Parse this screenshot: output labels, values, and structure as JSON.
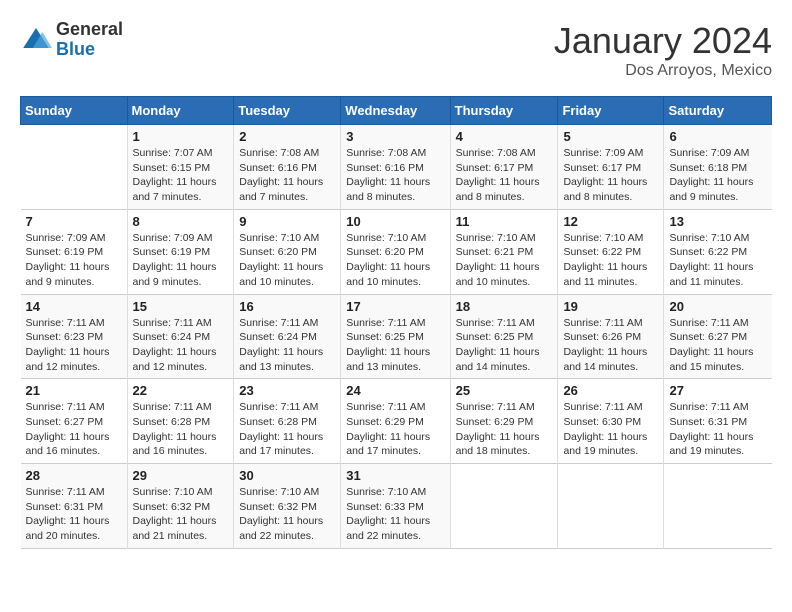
{
  "header": {
    "logo_general": "General",
    "logo_blue": "Blue",
    "month_year": "January 2024",
    "location": "Dos Arroyos, Mexico"
  },
  "columns": [
    "Sunday",
    "Monday",
    "Tuesday",
    "Wednesday",
    "Thursday",
    "Friday",
    "Saturday"
  ],
  "weeks": [
    [
      {
        "day": "",
        "info": ""
      },
      {
        "day": "1",
        "info": "Sunrise: 7:07 AM\nSunset: 6:15 PM\nDaylight: 11 hours\nand 7 minutes."
      },
      {
        "day": "2",
        "info": "Sunrise: 7:08 AM\nSunset: 6:16 PM\nDaylight: 11 hours\nand 7 minutes."
      },
      {
        "day": "3",
        "info": "Sunrise: 7:08 AM\nSunset: 6:16 PM\nDaylight: 11 hours\nand 8 minutes."
      },
      {
        "day": "4",
        "info": "Sunrise: 7:08 AM\nSunset: 6:17 PM\nDaylight: 11 hours\nand 8 minutes."
      },
      {
        "day": "5",
        "info": "Sunrise: 7:09 AM\nSunset: 6:17 PM\nDaylight: 11 hours\nand 8 minutes."
      },
      {
        "day": "6",
        "info": "Sunrise: 7:09 AM\nSunset: 6:18 PM\nDaylight: 11 hours\nand 9 minutes."
      }
    ],
    [
      {
        "day": "7",
        "info": "Sunrise: 7:09 AM\nSunset: 6:19 PM\nDaylight: 11 hours\nand 9 minutes."
      },
      {
        "day": "8",
        "info": "Sunrise: 7:09 AM\nSunset: 6:19 PM\nDaylight: 11 hours\nand 9 minutes."
      },
      {
        "day": "9",
        "info": "Sunrise: 7:10 AM\nSunset: 6:20 PM\nDaylight: 11 hours\nand 10 minutes."
      },
      {
        "day": "10",
        "info": "Sunrise: 7:10 AM\nSunset: 6:20 PM\nDaylight: 11 hours\nand 10 minutes."
      },
      {
        "day": "11",
        "info": "Sunrise: 7:10 AM\nSunset: 6:21 PM\nDaylight: 11 hours\nand 10 minutes."
      },
      {
        "day": "12",
        "info": "Sunrise: 7:10 AM\nSunset: 6:22 PM\nDaylight: 11 hours\nand 11 minutes."
      },
      {
        "day": "13",
        "info": "Sunrise: 7:10 AM\nSunset: 6:22 PM\nDaylight: 11 hours\nand 11 minutes."
      }
    ],
    [
      {
        "day": "14",
        "info": "Sunrise: 7:11 AM\nSunset: 6:23 PM\nDaylight: 11 hours\nand 12 minutes."
      },
      {
        "day": "15",
        "info": "Sunrise: 7:11 AM\nSunset: 6:24 PM\nDaylight: 11 hours\nand 12 minutes."
      },
      {
        "day": "16",
        "info": "Sunrise: 7:11 AM\nSunset: 6:24 PM\nDaylight: 11 hours\nand 13 minutes."
      },
      {
        "day": "17",
        "info": "Sunrise: 7:11 AM\nSunset: 6:25 PM\nDaylight: 11 hours\nand 13 minutes."
      },
      {
        "day": "18",
        "info": "Sunrise: 7:11 AM\nSunset: 6:25 PM\nDaylight: 11 hours\nand 14 minutes."
      },
      {
        "day": "19",
        "info": "Sunrise: 7:11 AM\nSunset: 6:26 PM\nDaylight: 11 hours\nand 14 minutes."
      },
      {
        "day": "20",
        "info": "Sunrise: 7:11 AM\nSunset: 6:27 PM\nDaylight: 11 hours\nand 15 minutes."
      }
    ],
    [
      {
        "day": "21",
        "info": "Sunrise: 7:11 AM\nSunset: 6:27 PM\nDaylight: 11 hours\nand 16 minutes."
      },
      {
        "day": "22",
        "info": "Sunrise: 7:11 AM\nSunset: 6:28 PM\nDaylight: 11 hours\nand 16 minutes."
      },
      {
        "day": "23",
        "info": "Sunrise: 7:11 AM\nSunset: 6:28 PM\nDaylight: 11 hours\nand 17 minutes."
      },
      {
        "day": "24",
        "info": "Sunrise: 7:11 AM\nSunset: 6:29 PM\nDaylight: 11 hours\nand 17 minutes."
      },
      {
        "day": "25",
        "info": "Sunrise: 7:11 AM\nSunset: 6:29 PM\nDaylight: 11 hours\nand 18 minutes."
      },
      {
        "day": "26",
        "info": "Sunrise: 7:11 AM\nSunset: 6:30 PM\nDaylight: 11 hours\nand 19 minutes."
      },
      {
        "day": "27",
        "info": "Sunrise: 7:11 AM\nSunset: 6:31 PM\nDaylight: 11 hours\nand 19 minutes."
      }
    ],
    [
      {
        "day": "28",
        "info": "Sunrise: 7:11 AM\nSunset: 6:31 PM\nDaylight: 11 hours\nand 20 minutes."
      },
      {
        "day": "29",
        "info": "Sunrise: 7:10 AM\nSunset: 6:32 PM\nDaylight: 11 hours\nand 21 minutes."
      },
      {
        "day": "30",
        "info": "Sunrise: 7:10 AM\nSunset: 6:32 PM\nDaylight: 11 hours\nand 22 minutes."
      },
      {
        "day": "31",
        "info": "Sunrise: 7:10 AM\nSunset: 6:33 PM\nDaylight: 11 hours\nand 22 minutes."
      },
      {
        "day": "",
        "info": ""
      },
      {
        "day": "",
        "info": ""
      },
      {
        "day": "",
        "info": ""
      }
    ]
  ]
}
